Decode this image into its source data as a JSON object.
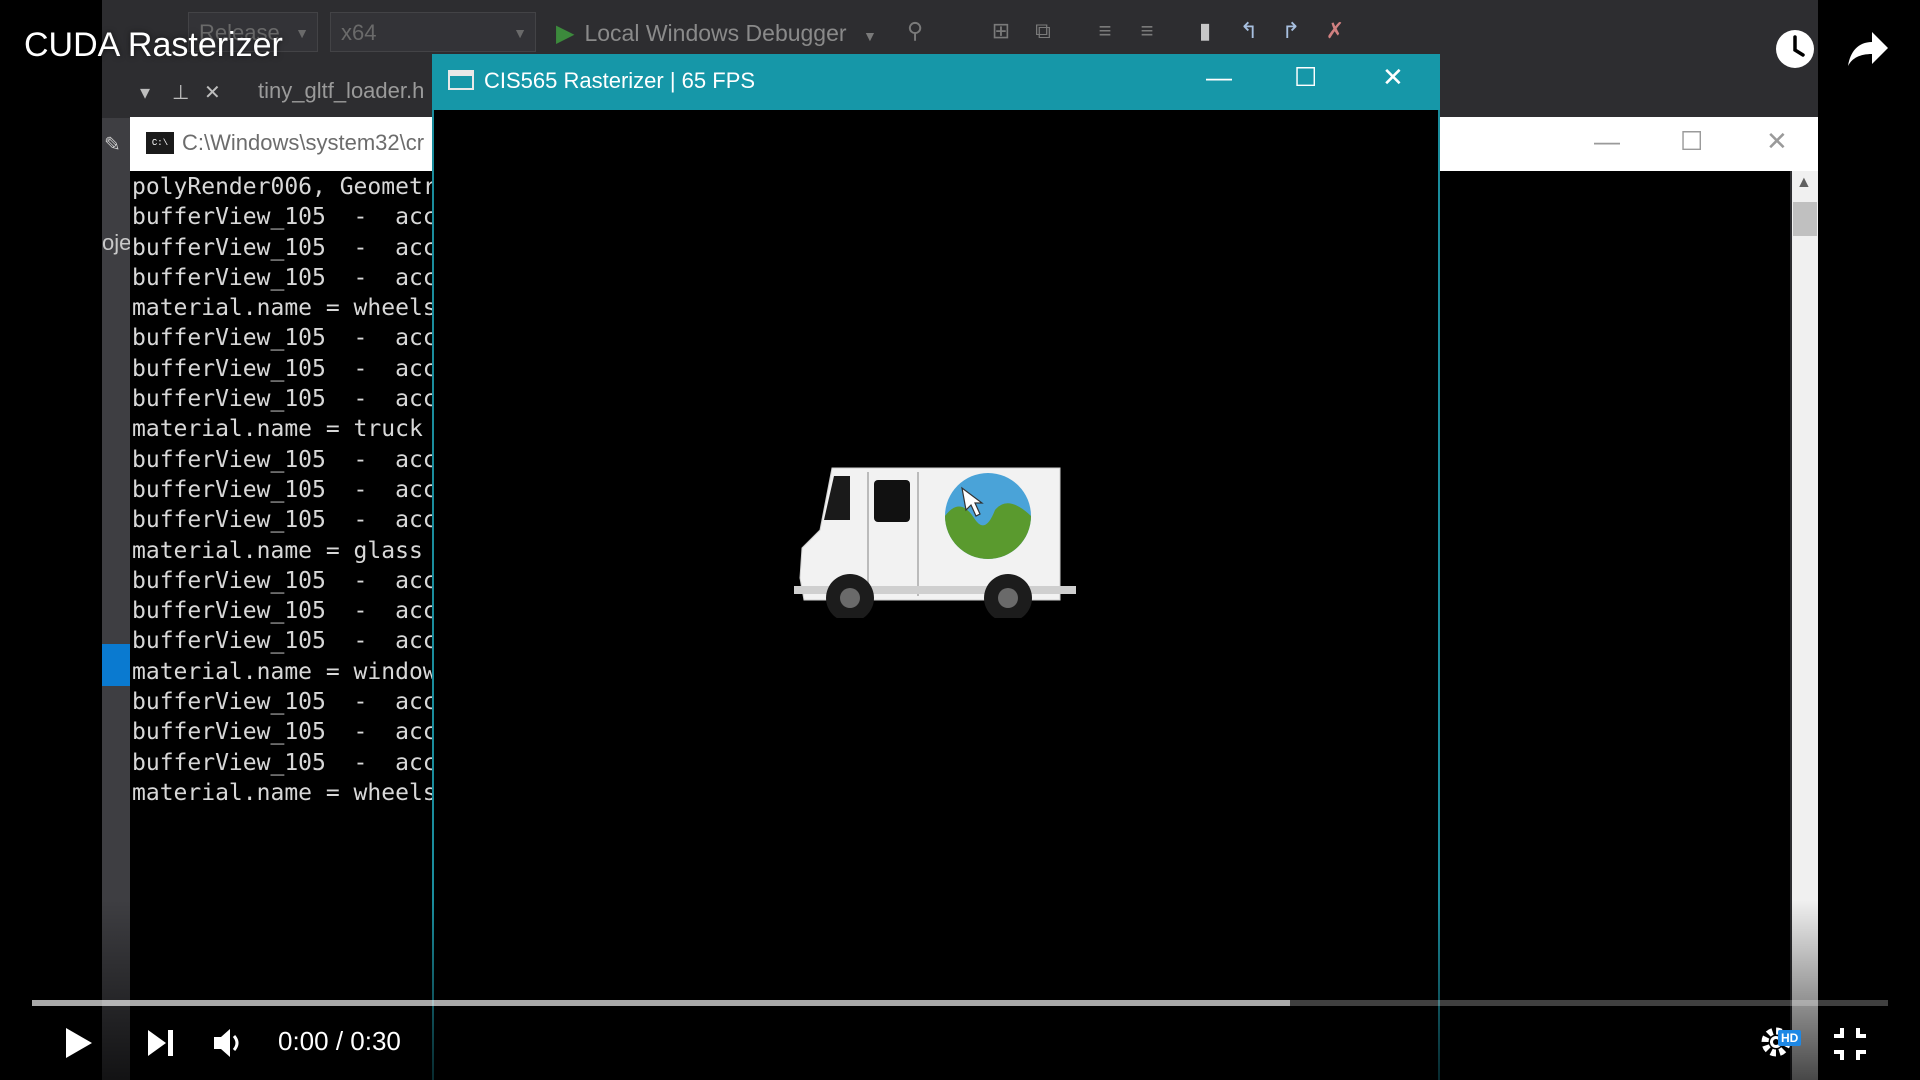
{
  "video": {
    "title": "CUDA Rasterizer",
    "time": "0:00 / 0:30",
    "loaded_fraction": 0.678,
    "quality_badge": "HD"
  },
  "ide": {
    "config": "Release",
    "platform": "x64",
    "debugger": "Local Windows Debugger",
    "tab_file": "tiny_gltf_loader.h",
    "side_text": "oje"
  },
  "console": {
    "path": "C:\\Windows\\system32\\cr",
    "icon_text": "C:\\",
    "lines": [
      "polyRender006, Geometr",
      "bufferView_105  -  acc",
      "bufferView_105  -  acc",
      "bufferView_105  -  acc",
      "material.name = wheels",
      "bufferView_105  -  acc",
      "bufferView_105  -  acc",
      "bufferView_105  -  acc",
      "material.name = truck",
      "bufferView_105  -  acc",
      "bufferView_105  -  acc",
      "bufferView_105  -  acc",
      "material.name = glass",
      "bufferView_105  -  acc",
      "bufferView_105  -  acc",
      "bufferView_105  -  acc",
      "material.name = window",
      "bufferView_105  -  acc",
      "bufferView_105  -  acc",
      "bufferView_105  -  acc",
      "material.name = wheels"
    ]
  },
  "rasterizer": {
    "title": "CIS565 Rasterizer | 65 FPS"
  },
  "colors": {
    "title_bar": "#1697a8",
    "progress_loaded": "#ffffff",
    "logo_blue": "#4aa3d8",
    "logo_green": "#5a9a2e"
  }
}
